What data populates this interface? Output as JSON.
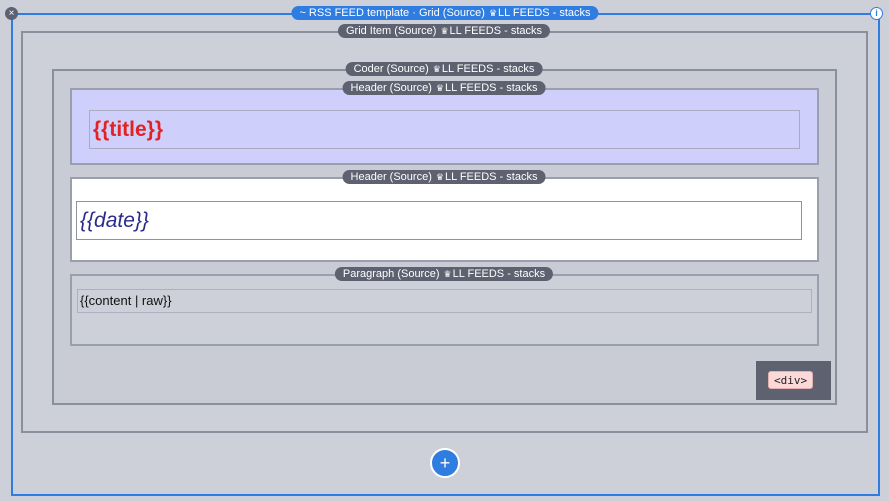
{
  "outer": {
    "label": "~ RSS FEED template · Grid (Source)",
    "library": "LL FEEDS - stacks",
    "close_glyph": "×",
    "info_glyph": "i",
    "add_glyph": "+"
  },
  "grid_item": {
    "label": "Grid Item (Source)",
    "library": "LL FEEDS - stacks"
  },
  "coder": {
    "label": "Coder (Source)",
    "library": "LL FEEDS - stacks"
  },
  "header_title": {
    "label": "Header (Source)",
    "library": "LL FEEDS - stacks",
    "text": "{{title}}"
  },
  "header_date": {
    "label": "Header (Source)",
    "library": "LL FEEDS - stacks",
    "text": "{{date}}"
  },
  "paragraph": {
    "label": "Paragraph (Source)",
    "library": "LL FEEDS - stacks",
    "text": "{{content | raw}}"
  },
  "div_tag": {
    "label": "<div>"
  },
  "icons": {
    "library": "crown-icon",
    "close": "close-icon",
    "info": "info-icon",
    "add": "plus-icon"
  },
  "colors": {
    "accent": "#2f7de1",
    "title_text": "#e02424",
    "date_text": "#2a2a8c",
    "title_bg": "#cfcffb",
    "tag_bg": "#5d6170"
  }
}
